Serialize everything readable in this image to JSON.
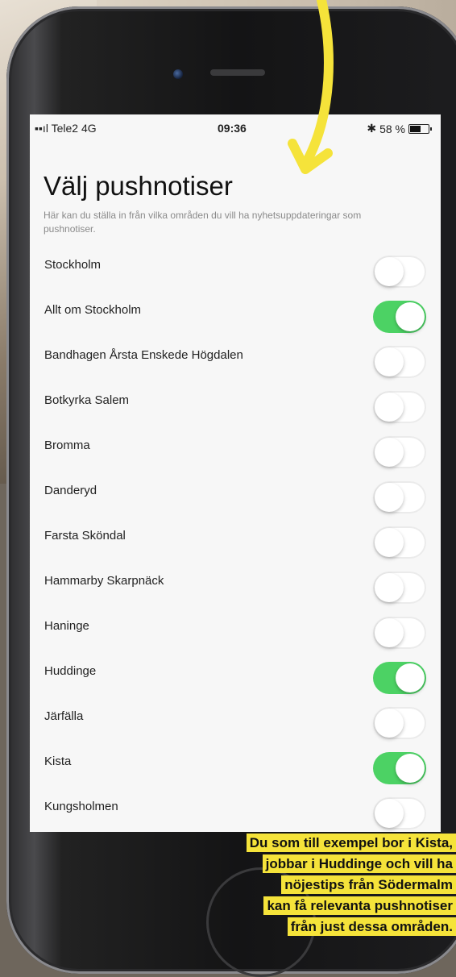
{
  "status_bar": {
    "carrier": "Tele2",
    "network": "4G",
    "time": "09:36",
    "bluetooth": "✱",
    "battery_percent_text": "58 %",
    "battery_level": 0.58
  },
  "page": {
    "title": "Välj pushnotiser",
    "subtitle": "Här kan du ställa in från vilka områden du vill ha nyhetsuppdateringar som pushnotiser."
  },
  "settings": [
    {
      "label": "Stockholm",
      "on": false
    },
    {
      "label": "Allt om Stockholm",
      "on": true
    },
    {
      "label": "Bandhagen Årsta Enskede Högdalen",
      "on": false
    },
    {
      "label": "Botkyrka Salem",
      "on": false
    },
    {
      "label": "Bromma",
      "on": false
    },
    {
      "label": "Danderyd",
      "on": false
    },
    {
      "label": "Farsta Sköndal",
      "on": false
    },
    {
      "label": "Hammarby Skarpnäck",
      "on": false
    },
    {
      "label": "Haninge",
      "on": false
    },
    {
      "label": "Huddinge",
      "on": true
    },
    {
      "label": "Järfälla",
      "on": false
    },
    {
      "label": "Kista",
      "on": true
    },
    {
      "label": "Kungsholmen",
      "on": false
    }
  ],
  "caption": {
    "lines": [
      "Du som till exempel bor i Kista,",
      "jobbar i Huddinge och vill ha",
      "nöjestips från Södermalm",
      "kan få relevanta pushnotiser",
      "från just dessa områden."
    ]
  },
  "colors": {
    "toggle_on": "#4cd264",
    "arrow": "#f5e33a",
    "caption_bg": "#f5e33a"
  }
}
